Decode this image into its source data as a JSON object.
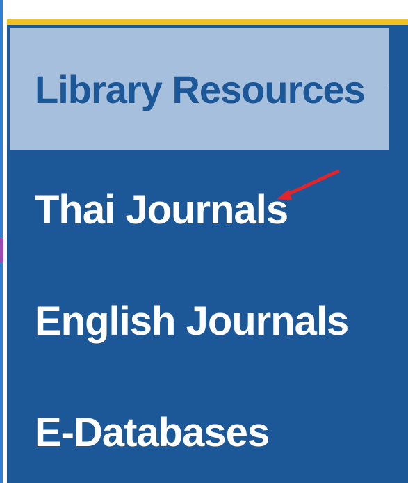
{
  "menu": {
    "header_label": "Library Resources",
    "header_icon": "chevron-down-icon",
    "items": [
      {
        "label": "Thai Journals"
      },
      {
        "label": "English Journals"
      },
      {
        "label": "E-Databases"
      }
    ]
  },
  "annotation": {
    "arrow_icon": "red-arrow-icon",
    "arrow_color": "#e3242b"
  },
  "colors": {
    "menu_background": "#1c5797",
    "header_background": "#a6bfdc",
    "header_text": "#1c5797",
    "item_text": "#ffffff",
    "accent_line": "#f2c320"
  }
}
